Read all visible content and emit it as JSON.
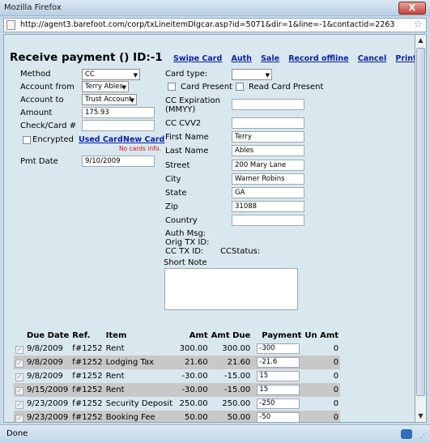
{
  "window": {
    "title": "Mozilla Firefox",
    "close_label": "X"
  },
  "browser": {
    "url": "http://agent3.barefoot.com/corp/txLineitemDlgcar.asp?id=5071&dir=1&line=-1&contactid=2263",
    "status": "Done"
  },
  "header": {
    "title": "Receive payment  () ID:-1",
    "links": [
      "Swipe Card",
      "Auth",
      "Sale",
      "Record offline",
      "Cancel",
      "Print"
    ]
  },
  "left_form": {
    "method_label": "Method",
    "method_value": "CC",
    "account_from_label": "Account from",
    "account_from_value": "Terry Ables",
    "account_to_label": "Account to",
    "account_to_value": "Trust Account",
    "amount_label": "Amount",
    "amount_value": "175.93",
    "check_card_label": "Check/Card #",
    "check_card_value": "",
    "encrypted_label": "Encrypted",
    "used_card_label": "Used Card",
    "new_card_label": "New Card",
    "no_cards_text": "No cards info.",
    "pmt_date_label": "Pmt Date",
    "pmt_date_value": "9/10/2009"
  },
  "right_form": {
    "card_type_label": "Card type:",
    "card_type_value": "",
    "card_present_label": "Card Present",
    "read_card_present_label": "Read Card Present",
    "cc_expiration_label": "CC Expiration",
    "cc_expiration_hint": "(MMYY)",
    "cc_expiration_value": "",
    "cc_cvv2_label": "CC CVV2",
    "cc_cvv2_value": "",
    "first_name_label": "First Name",
    "first_name_value": "Terry",
    "last_name_label": "Last Name",
    "last_name_value": "Ables",
    "street_label": "Street",
    "street_value": "200 Mary Lane",
    "city_label": "City",
    "city_value": "Warner Robins",
    "state_label": "State",
    "state_value": "GA",
    "zip_label": "Zip",
    "zip_value": "31088",
    "country_label": "Country",
    "country_value": "",
    "auth_msg_label": "Auth Msg:",
    "orig_tx_id_label": "Orig TX ID:",
    "cc_tx_id_label": "CC TX ID:",
    "cc_status_label": "CCStatus:",
    "short_note_label": "Short Note"
  },
  "grid": {
    "columns": [
      "Due Date",
      "Ref.",
      "Item",
      "Amt",
      "Amt Due",
      "Payment",
      "Un Amt"
    ],
    "rows": [
      {
        "due": "9/8/2009",
        "ref": "f#1252",
        "item": "Rent",
        "amt": "300.00",
        "amt_due": "300.00",
        "payment": "-300",
        "un_amt": "0"
      },
      {
        "due": "9/8/2009",
        "ref": "f#1252",
        "item": "Lodging Tax",
        "amt": "21.60",
        "amt_due": "21.60",
        "payment": "-21.6",
        "un_amt": "0"
      },
      {
        "due": "9/8/2009",
        "ref": "f#1252",
        "item": "Rent",
        "amt": "-30.00",
        "amt_due": "-15.00",
        "payment": "15",
        "un_amt": "0"
      },
      {
        "due": "9/15/2009",
        "ref": "f#1252",
        "item": "Rent",
        "amt": "-30.00",
        "amt_due": "-15.00",
        "payment": "15",
        "un_amt": "0"
      },
      {
        "due": "9/23/2009",
        "ref": "f#1252",
        "item": "Security Deposit",
        "amt": "250.00",
        "amt_due": "250.00",
        "payment": "-250",
        "un_amt": "0"
      },
      {
        "due": "9/23/2009",
        "ref": "f#1252",
        "item": "Booking Fee",
        "amt": "50.00",
        "amt_due": "50.00",
        "payment": "-50",
        "un_amt": "0"
      }
    ]
  }
}
